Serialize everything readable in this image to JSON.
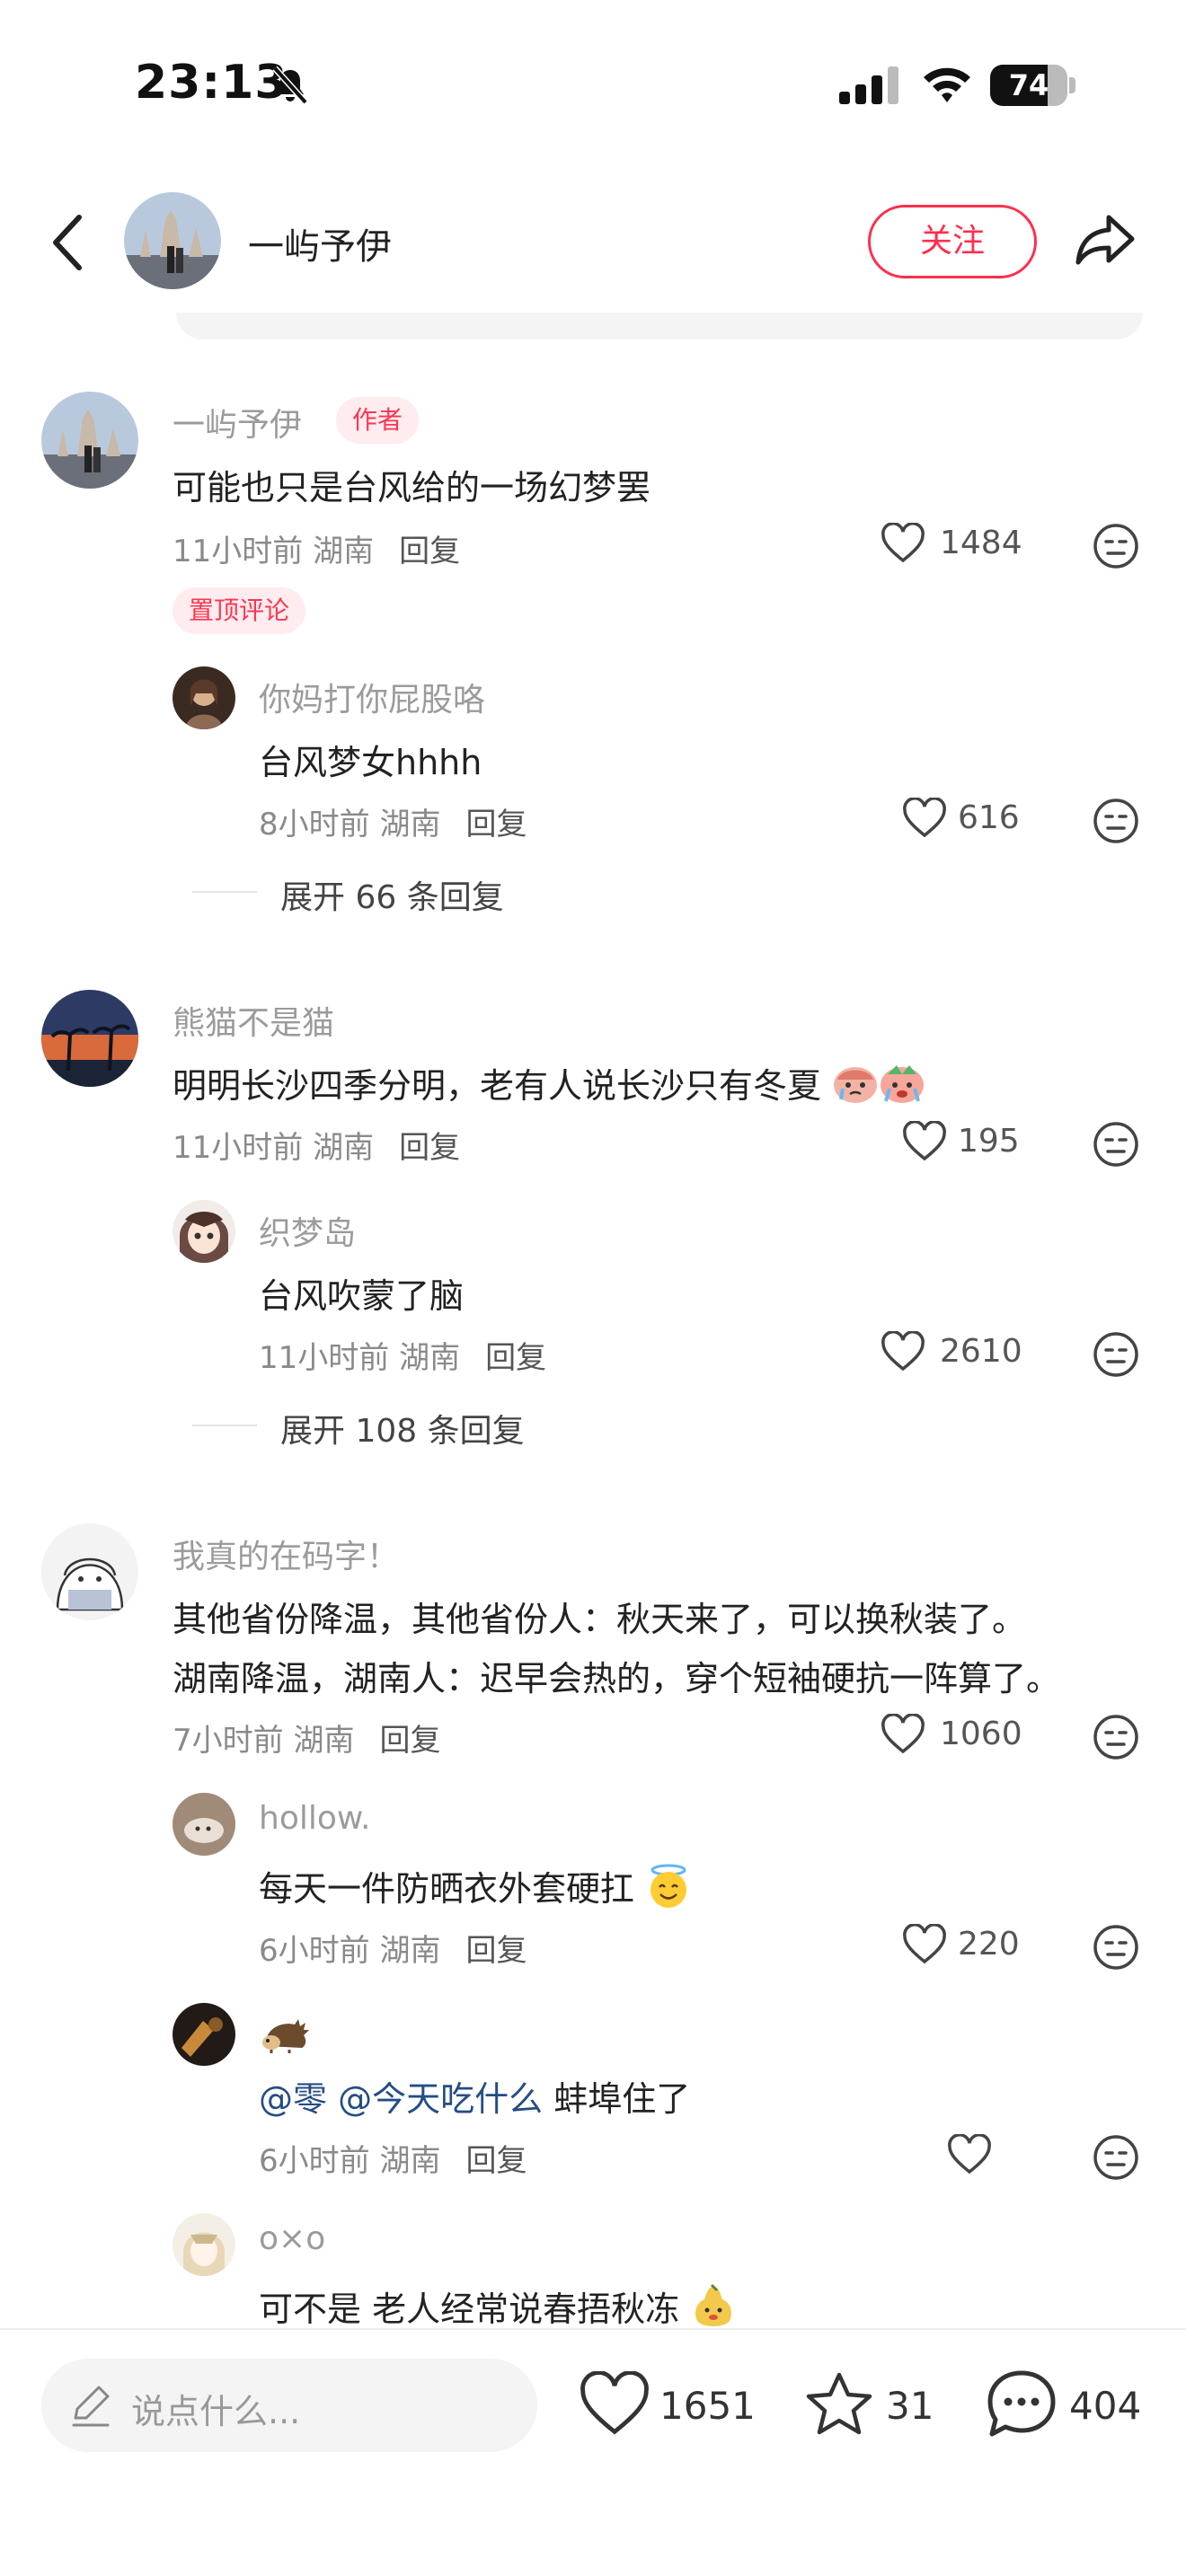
{
  "status_bar": {
    "time": "23:13",
    "battery": "74",
    "battery_level": 0.74
  },
  "header": {
    "name": "一屿予伊",
    "follow_label": "关注"
  },
  "comments": [
    {
      "name": "一屿予伊",
      "author_tag": "作者",
      "text": "可能也只是台风给的一场幻梦罢",
      "time": "11小时前 湖南",
      "reply_label": "回复",
      "likes": "1484",
      "pinned_label": "置顶评论",
      "replies": [
        {
          "name": "你妈打你屁股咯",
          "text": "台风梦女hhhh",
          "time": "8小时前 湖南",
          "reply_label": "回复",
          "likes": "616"
        }
      ],
      "expand_label": "展开 66 条回复"
    },
    {
      "name": "熊猫不是猫",
      "text": "明明长沙四季分明，老有人说长沙只有冬夏",
      "time": "11小时前 湖南",
      "reply_label": "回复",
      "likes": "195",
      "replies": [
        {
          "name": "织梦岛",
          "text": "台风吹蒙了脑",
          "time": "11小时前 湖南",
          "reply_label": "回复",
          "likes": "2610"
        }
      ],
      "expand_label": "展开 108 条回复"
    },
    {
      "name": "我真的在码字！",
      "text_line1": "其他省份降温，其他省份人：秋天来了，可以换秋装了。",
      "text_line2": "湖南降温，湖南人：迟早会热的，穿个短袖硬抗一阵算了。",
      "time": "7小时前 湖南",
      "reply_label": "回复",
      "likes": "1060",
      "replies": [
        {
          "name": "hollow.",
          "text": "每天一件防晒衣外套硬扛",
          "time": "6小时前 湖南",
          "reply_label": "回复",
          "likes": "220"
        },
        {
          "name": "",
          "mention1": "@零",
          "mention2": "@今天吃什么",
          "text": "蚌埠住了",
          "time": "6小时前 湖南",
          "reply_label": "回复",
          "likes": ""
        },
        {
          "name": "o×o",
          "text": "可不是 老人经常说春捂秋冻"
        }
      ]
    }
  ],
  "bottom_bar": {
    "input_placeholder": "说点什么...",
    "like_count": "1651",
    "star_count": "31",
    "comment_count": "404"
  },
  "colors": {
    "accent": "#ff2e4d",
    "mention": "#244d84",
    "tag_bg": "#ffecee"
  }
}
